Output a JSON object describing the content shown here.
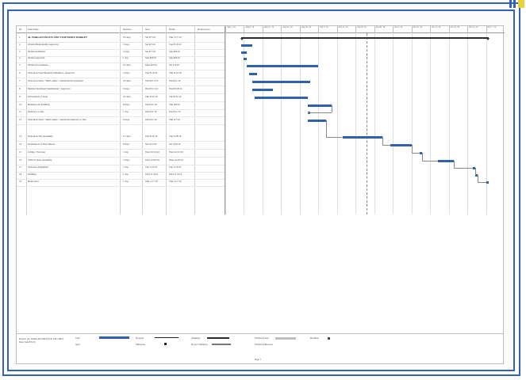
{
  "colors": {
    "frame": "#2f62b8",
    "task_bar": "#2f63a9",
    "summary_bar": "#2b2b2b",
    "corner_a": "#2f62b8",
    "corner_b": "#e8d23a"
  },
  "table": {
    "headers": [
      "ID",
      "Task Name",
      "Duration",
      "Start",
      "Finish",
      "Predecessors"
    ],
    "rows": [
      {
        "id": "1",
        "name": "AL WARGAN FRUITS AND VEGETABLE MARKET",
        "duration": "79 days",
        "start": "Sat 8/7/10",
        "finish": "Thu 11/7/10",
        "summary": true
      },
      {
        "id": "2",
        "name": "Obtain Municipality Approval",
        "duration": "3 days",
        "start": "Sat 8/7/10",
        "finish": "Tue 8/10/10",
        "summary": false
      },
      {
        "id": "3",
        "name": "Obtain Submittal",
        "duration": "2 days",
        "start": "Sat 8/7/10",
        "finish": "Sun 8/8/10",
        "summary": false
      },
      {
        "id": "4",
        "name": "Obtain Approval",
        "duration": "1 day",
        "start": "Sun 8/8/10",
        "finish": "Sun 8/8/10",
        "summary": false
      },
      {
        "id": "5",
        "name": "Obtain Procurement",
        "duration": "25 days",
        "start": "Mon 8/9/10",
        "finish": "Sat 9/4/10",
        "summary": false
      },
      {
        "id": "6",
        "name": "Structural Steel Material Submittal / Approval",
        "duration": "3 days",
        "start": "Tue 8/10/10",
        "finish": "Thu 8/12/10",
        "summary": false
      },
      {
        "id": "7",
        "name": "Structural Steel / Shell Gutter / Sandwich Procurement",
        "duration": "23 days",
        "start": "Wed 8/11/10",
        "finish": "Wed 9/1/10",
        "summary": false
      },
      {
        "id": "8",
        "name": "Method Statement Submission / Approval",
        "duration": "8 days",
        "start": "Wed 8/11/10",
        "finish": "Wed 8/18/10",
        "summary": false
      },
      {
        "id": "9",
        "name": "Fabrication of Steel",
        "duration": "22 days",
        "start": "Thu 8/12/10",
        "finish": "Tue 8/31/10",
        "summary": false
      },
      {
        "id": "10",
        "name": "Blasting and Painting",
        "duration": "8 days",
        "start": "Wed 9/1/10",
        "finish": "Thu 9/9/10",
        "summary": false
      },
      {
        "id": "11",
        "name": "Delivery to Site",
        "duration": "1 day",
        "start": "Wed 9/1/10",
        "finish": "Wed 9/1/10",
        "summary": false
      },
      {
        "id": "12",
        "name": "Structural Steel / Shell Gutter / Sandwich Delivery to Site",
        "duration": "6 days",
        "start": "Wed 9/1/10",
        "finish": "Thu 9/7/10",
        "summary": false
      },
      {
        "id": "13",
        "name": "Structural Site Assembly",
        "duration": "15 days",
        "start": "Tue 9/14/10",
        "finish": "Tue 9/28/10",
        "summary": false
      },
      {
        "id": "14",
        "name": "Installation of Steel Sheets",
        "duration": "8 days",
        "start": "Sat 10/2/10",
        "finish": "Sat 10/9/10",
        "summary": false
      },
      {
        "id": "15",
        "name": "Lifting / Erection",
        "duration": "1 day",
        "start": "Wed 10/13/10",
        "finish": "Wed 10/13/10",
        "summary": false
      },
      {
        "id": "16",
        "name": "Vertical Steel Assembly",
        "duration": "5 days",
        "start": "Wed 10/20/10",
        "finish": "Mon 10/25/10",
        "summary": false
      },
      {
        "id": "17",
        "name": "Structure Alignment",
        "duration": "1 day",
        "start": "Tue 11/2/10",
        "finish": "Tue 11/2/10",
        "summary": false
      },
      {
        "id": "18",
        "name": "Painting",
        "duration": "1 day",
        "start": "Wed 11/3/10",
        "finish": "Wed 11/3/10",
        "summary": false
      },
      {
        "id": "19",
        "name": "Hand Over",
        "duration": "1 day",
        "start": "Thu 11/7/10",
        "finish": "Thu 11/7/10",
        "summary": false
      }
    ]
  },
  "timescale": [
    "Aug 1, '10",
    "Aug 8, '10",
    "Aug 15, '10",
    "Aug 22, '10",
    "Aug 29, '10",
    "Sep 5, '10",
    "Sep 12, '10",
    "Sep 19, '10",
    "Sep 26, '10",
    "Oct 3, '10",
    "Oct 10, '10",
    "Oct 17, '10",
    "Oct 24, '10",
    "Oct 31, '10",
    "Nov 7, '10"
  ],
  "legend": {
    "project_label": "Project: AL WARGAN FRUITS & VEG MKT\nDate: Sun 8/8/10",
    "items": [
      "Task",
      "Split",
      "Progress",
      "Milestone",
      "Summary",
      "Project Summary",
      "External Tasks",
      "External Milestone",
      "Deadline"
    ],
    "page": "Page 1"
  }
}
